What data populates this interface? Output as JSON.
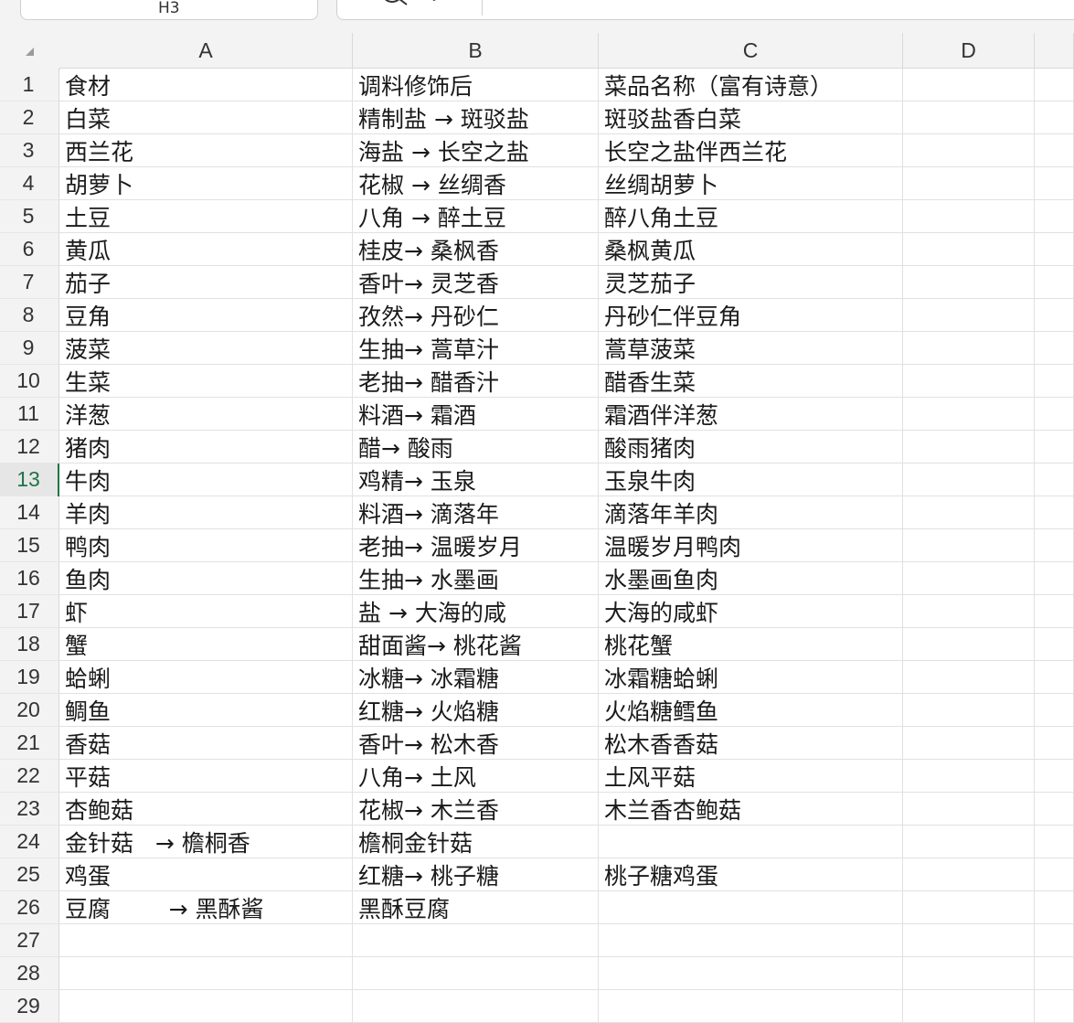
{
  "name_box": "H3",
  "formula_bar": {
    "icons": [
      "zoom-icon",
      "fx-icon"
    ],
    "value": ""
  },
  "columns": [
    "A",
    "B",
    "C",
    "D"
  ],
  "active_row": 13,
  "row_numbers": [
    "1",
    "2",
    "3",
    "4",
    "5",
    "6",
    "7",
    "8",
    "9",
    "10",
    "11",
    "12",
    "13",
    "14",
    "15",
    "16",
    "17",
    "18",
    "19",
    "20",
    "21",
    "22",
    "23",
    "24",
    "25",
    "26",
    "27",
    "28",
    "29"
  ],
  "rows": [
    [
      "食材",
      "调料修饰后",
      "菜品名称（富有诗意）",
      ""
    ],
    [
      "白菜",
      "精制盐 → 斑驳盐",
      "斑驳盐香白菜",
      ""
    ],
    [
      "西兰花",
      "海盐 → 长空之盐",
      "长空之盐伴西兰花",
      ""
    ],
    [
      "胡萝卜",
      "花椒 → 丝绸香",
      "丝绸胡萝卜",
      ""
    ],
    [
      "土豆",
      "八角 → 醉土豆",
      "醉八角土豆",
      ""
    ],
    [
      "黄瓜",
      "桂皮→ 桑枫香",
      "桑枫黄瓜",
      ""
    ],
    [
      "茄子",
      "香叶→ 灵芝香",
      "灵芝茄子",
      ""
    ],
    [
      "豆角",
      "孜然→ 丹砂仁",
      "丹砂仁伴豆角",
      ""
    ],
    [
      "菠菜",
      "生抽→ 蒿草汁",
      "蒿草菠菜",
      ""
    ],
    [
      "生菜",
      "老抽→ 醋香汁",
      "醋香生菜",
      ""
    ],
    [
      "洋葱",
      "料酒→ 霜酒",
      "霜酒伴洋葱",
      ""
    ],
    [
      "猪肉",
      "醋→ 酸雨",
      "酸雨猪肉",
      ""
    ],
    [
      "牛肉",
      "鸡精→ 玉泉",
      "玉泉牛肉",
      ""
    ],
    [
      "羊肉",
      "料酒→ 滴落年",
      "滴落年羊肉",
      ""
    ],
    [
      "鸭肉",
      "老抽→ 温暖岁月",
      "温暖岁月鸭肉",
      ""
    ],
    [
      "鱼肉",
      "生抽→ 水墨画",
      "水墨画鱼肉",
      ""
    ],
    [
      "虾",
      "盐 → 大海的咸",
      "大海的咸虾",
      ""
    ],
    [
      "蟹",
      "甜面酱→ 桃花酱",
      "桃花蟹",
      ""
    ],
    [
      "蛤蜊",
      "冰糖→ 冰霜糖",
      "冰霜糖蛤蜊",
      ""
    ],
    [
      "鲷鱼",
      "红糖→ 火焰糖",
      "火焰糖鳕鱼",
      ""
    ],
    [
      "香菇",
      "香叶→ 松木香",
      "松木香香菇",
      ""
    ],
    [
      "平菇",
      "八角→ 土风",
      "土风平菇",
      ""
    ],
    [
      "杏鲍菇",
      "花椒→ 木兰香",
      "木兰香杏鲍菇",
      ""
    ],
    [
      "金针菇   → 檐桐香",
      "檐桐金针菇",
      "",
      ""
    ],
    [
      "鸡蛋",
      "红糖→ 桃子糖",
      "桃子糖鸡蛋",
      ""
    ],
    [
      "豆腐        → 黑酥酱",
      "黑酥豆腐",
      "",
      ""
    ],
    [
      "",
      "",
      "",
      ""
    ],
    [
      "",
      "",
      "",
      ""
    ],
    [
      "",
      "",
      "",
      ""
    ]
  ]
}
